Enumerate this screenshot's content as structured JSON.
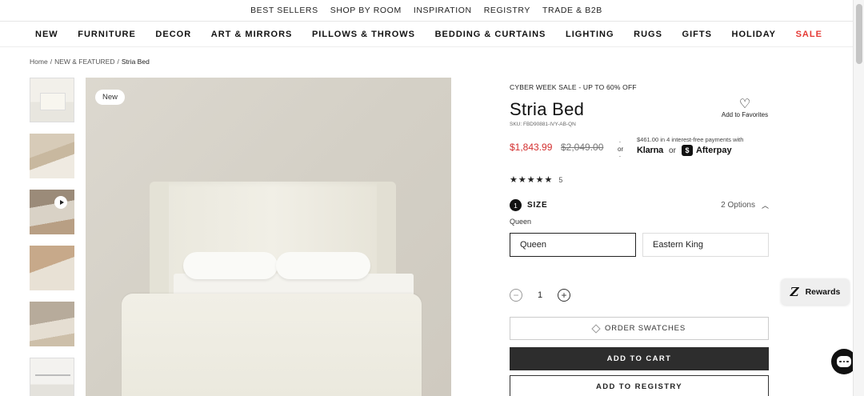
{
  "util_nav": [
    "BEST SELLERS",
    "SHOP BY ROOM",
    "INSPIRATION",
    "REGISTRY",
    "TRADE & B2B"
  ],
  "main_nav": [
    "NEW",
    "FURNITURE",
    "DECOR",
    "ART & MIRRORS",
    "PILLOWS & THROWS",
    "BEDDING & CURTAINS",
    "LIGHTING",
    "RUGS",
    "GIFTS",
    "HOLIDAY",
    "SALE"
  ],
  "breadcrumb": {
    "home": "Home",
    "sep": "/",
    "category": "NEW & FEATURED",
    "current": "Stria Bed"
  },
  "gallery": {
    "badge": "New",
    "thumbnails": [
      "thumbnail-1",
      "thumbnail-2",
      "thumbnail-3-video",
      "thumbnail-4",
      "thumbnail-5",
      "thumbnail-6"
    ]
  },
  "product": {
    "promo": "CYBER WEEK SALE - UP TO 60% OFF",
    "title": "Stria Bed",
    "sku": "SKU: FBD90881-IVY-AB-QN",
    "favorite_label": "Add to Favorites",
    "sale_price": "$1,843.99",
    "original_price": "$2,049.00",
    "or_label": "or",
    "installment_text": "$461.00 in 4 interest-free payments with",
    "klarna": "Klarna",
    "payment_or": "or",
    "afterpay": "Afterpay",
    "rating_stars": "★★★★★",
    "rating_value": 5,
    "rating_count": "5"
  },
  "size": {
    "step": "1",
    "label": "SIZE",
    "options_count": "2 Options",
    "selected": "Queen",
    "options": [
      "Queen",
      "Eastern King"
    ]
  },
  "quantity": {
    "minus": "−",
    "value": "1",
    "plus": "+"
  },
  "buttons": {
    "swatches": "ORDER SWATCHES",
    "cart": "ADD TO CART",
    "registry": "ADD TO REGISTRY"
  },
  "rewards": {
    "logo": "Z",
    "label": "Rewards"
  },
  "colors": {
    "sale_red": "#d32f2f",
    "cart_bg": "#2d2d2d",
    "nav_sale": "#e53935"
  }
}
